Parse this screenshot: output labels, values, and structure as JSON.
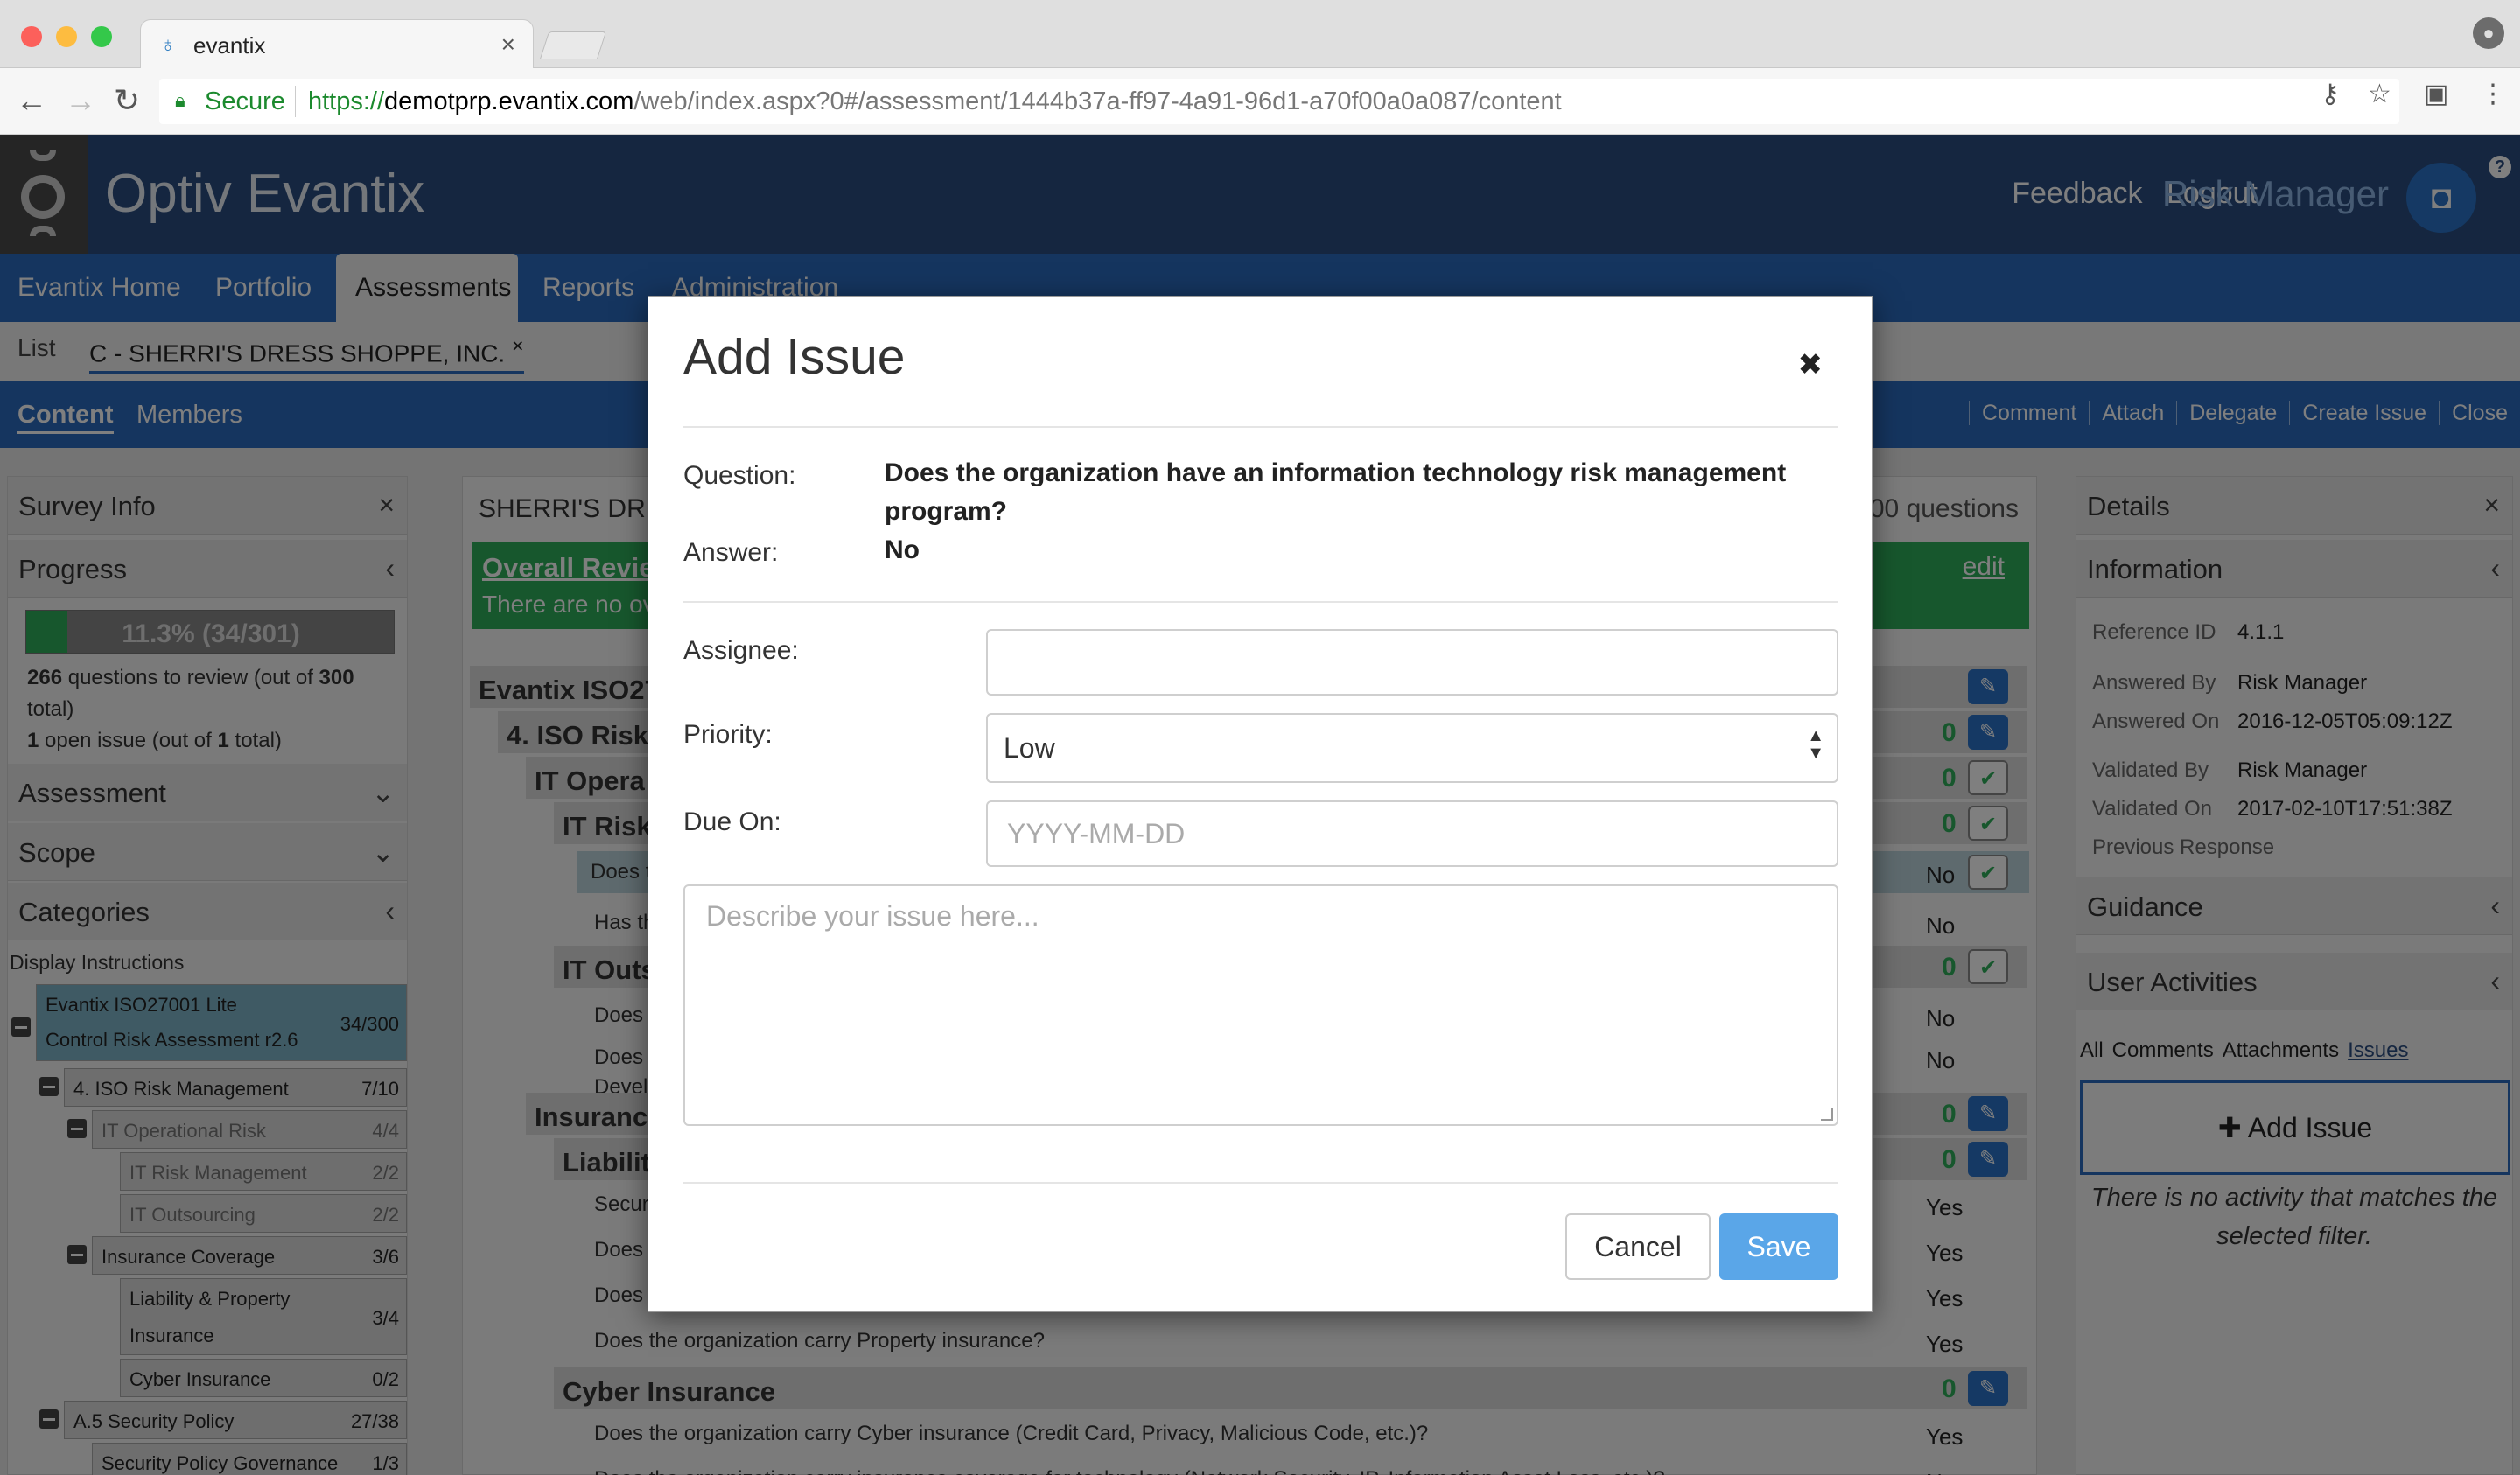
{
  "browser": {
    "tab_title": "evantix",
    "secure_label": "Secure",
    "url_scheme": "https://",
    "url_host": "demotprp.evantix.com",
    "url_path": "/web/index.aspx?0#/assessment/1444b37a-ff97-4a91-96d1-a70f00a0a087/content"
  },
  "app": {
    "title": "Optiv Evantix",
    "feedback": "Feedback",
    "logout": "Logout",
    "role": "Risk Manager",
    "help": "?"
  },
  "main_nav": [
    "Evantix Home",
    "Portfolio",
    "Assessments",
    "Reports",
    "Administration"
  ],
  "subheader": {
    "list": "List",
    "assessment": "C - SHERRI'S DRESS SHOPPE, INC.",
    "close": "×"
  },
  "toolbar": {
    "content": "Content",
    "members": "Members",
    "actions": [
      "Comment",
      "Attach",
      "Delegate",
      "Create Issue",
      "Close"
    ]
  },
  "left": {
    "survey_info": "Survey Info",
    "progress": "Progress",
    "progress_value": 0.113,
    "progress_label": "11.3% (34/301)",
    "review_count": "266",
    "review_text": "questions to review (out of",
    "review_total": "300",
    "review_end": "total)",
    "issue_count": "1",
    "issue_text": "open issue (out of",
    "issue_total": "1",
    "issue_end": "total)",
    "assessment": "Assessment",
    "scope": "Scope",
    "categories": "Categories",
    "display_instructions": "Display Instructions",
    "tree": [
      {
        "name": "Evantix ISO27001 Lite",
        "name2": "Control Risk Assessment r2.6",
        "count": "34/300"
      },
      {
        "name": "4. ISO Risk Management",
        "count": "7/10"
      },
      {
        "name": "IT Operational Risk",
        "count": "4/4"
      },
      {
        "name": "IT Risk Management",
        "count": "2/2"
      },
      {
        "name": "IT Outsourcing",
        "count": "2/2"
      },
      {
        "name": "Insurance Coverage",
        "count": "3/6"
      },
      {
        "name": "Liability & Property",
        "name2": "Insurance",
        "count": "3/4"
      },
      {
        "name": "Cyber Insurance",
        "count": "0/2"
      },
      {
        "name": "A.5 Security Policy",
        "count": "27/38"
      },
      {
        "name": "Security Policy Governance",
        "count": "1/3"
      }
    ]
  },
  "center": {
    "heading": "SHERRI'S DRE",
    "questions": "00 questions",
    "review_title": "Overall Revie",
    "review_sub": "There are no ov",
    "edit": "edit",
    "rows": [
      {
        "t": "Evantix ISO27",
        "lvl": 0,
        "kind": "section",
        "icon": "pencil"
      },
      {
        "t": "4. ISO Risk",
        "lvl": 1,
        "kind": "section",
        "zero": "0",
        "icon": "pencil"
      },
      {
        "t": "IT Opera",
        "lvl": 2,
        "kind": "section",
        "zero": "0",
        "icon": "check"
      },
      {
        "t": "IT Risk",
        "lvl": 3,
        "kind": "section",
        "zero": "0",
        "icon": "check"
      },
      {
        "t": "Does t",
        "lvl": 4,
        "kind": "q",
        "val": "No",
        "icon": "check"
      },
      {
        "t": "Has th",
        "lvl": 4,
        "kind": "q",
        "val": "No"
      },
      {
        "t": "IT Outs",
        "lvl": 3,
        "kind": "section",
        "zero": "0",
        "icon": "check"
      },
      {
        "t": "Does t",
        "lvl": 4,
        "kind": "q",
        "val": "No"
      },
      {
        "t": "Does t",
        "t2": "Develo",
        "lvl": 4,
        "kind": "q",
        "val": "No"
      },
      {
        "t": "Insurance",
        "lvl": 2,
        "kind": "section",
        "zero": "0",
        "icon": "pencil"
      },
      {
        "t": "Liabilit",
        "lvl": 3,
        "kind": "section",
        "zero": "0",
        "icon": "pencil"
      },
      {
        "t": "Securit",
        "lvl": 4,
        "kind": "q",
        "val": "Yes"
      },
      {
        "t": "Does t",
        "lvl": 4,
        "kind": "q",
        "val": "Yes"
      },
      {
        "t": "Does t",
        "lvl": 4,
        "kind": "q",
        "val": "Yes"
      },
      {
        "t": "Does the organization carry Property insurance?",
        "lvl": 4,
        "kind": "q",
        "val": "Yes"
      },
      {
        "t": "Cyber Insurance",
        "lvl": 3,
        "kind": "section",
        "zero": "0",
        "icon": "pencil"
      },
      {
        "t": "Does the organization carry Cyber insurance (Credit Card, Privacy, Malicious Code, etc.)?",
        "lvl": 4,
        "kind": "q",
        "val": "Yes"
      },
      {
        "t": "Does the organization carry insurance coverage for technology (Network Security, IP, Information Asset Loss, etc.)?",
        "lvl": 4,
        "kind": "q",
        "val": "No"
      }
    ]
  },
  "right": {
    "details": "Details",
    "information": "Information",
    "reference_id_label": "Reference ID",
    "reference_id": "4.1.1",
    "answered_by_label": "Answered By",
    "answered_by": "Risk Manager",
    "answered_on_label": "Answered On",
    "answered_on": "2016-12-05T05:09:12Z",
    "validated_by_label": "Validated By",
    "validated_by": "Risk Manager",
    "validated_on_label": "Validated On",
    "validated_on": "2017-02-10T17:51:38Z",
    "previous_response": "Previous Response",
    "guidance": "Guidance",
    "user_activities": "User Activities",
    "filters": [
      "All",
      "Comments",
      "Attachments",
      "Issues"
    ],
    "add_issue": "Add Issue",
    "no_activity": "There is no activity that matches the selected filter."
  },
  "modal": {
    "title": "Add Issue",
    "question_label": "Question:",
    "question": "Does the organization have an information technology risk management program?",
    "answer_label": "Answer:",
    "answer": "No",
    "assignee_label": "Assignee:",
    "assignee_value": "",
    "priority_label": "Priority:",
    "priority_value": "Low",
    "due_label": "Due On:",
    "due_placeholder": "YYYY-MM-DD",
    "desc_placeholder": "Describe your issue here...",
    "cancel": "Cancel",
    "save": "Save"
  },
  "colors": {
    "brand_blue": "#2a6bbf",
    "header_blue": "#2a4d80",
    "success_green": "#2fae5a",
    "save_blue": "#5aa6e8"
  }
}
